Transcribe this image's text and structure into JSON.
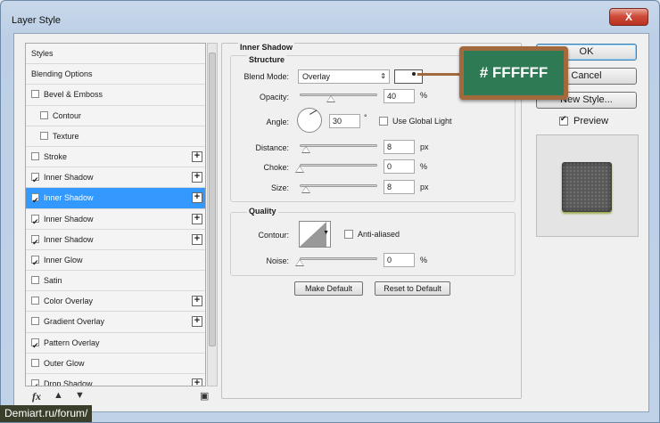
{
  "window": {
    "title": "Layer Style",
    "close_glyph": "X"
  },
  "styles_list": [
    {
      "label": "Styles",
      "checkbox": false,
      "checked": false,
      "plus": false,
      "indent": 0,
      "selected": false
    },
    {
      "label": "Blending Options",
      "checkbox": false,
      "checked": false,
      "plus": false,
      "indent": 0,
      "selected": false
    },
    {
      "label": "Bevel & Emboss",
      "checkbox": true,
      "checked": false,
      "plus": false,
      "indent": 0,
      "selected": false
    },
    {
      "label": "Contour",
      "checkbox": true,
      "checked": false,
      "plus": false,
      "indent": 1,
      "selected": false
    },
    {
      "label": "Texture",
      "checkbox": true,
      "checked": false,
      "plus": false,
      "indent": 1,
      "selected": false
    },
    {
      "label": "Stroke",
      "checkbox": true,
      "checked": false,
      "plus": true,
      "indent": 0,
      "selected": false
    },
    {
      "label": "Inner Shadow",
      "checkbox": true,
      "checked": true,
      "plus": true,
      "indent": 0,
      "selected": false
    },
    {
      "label": "Inner Shadow",
      "checkbox": true,
      "checked": true,
      "plus": true,
      "indent": 0,
      "selected": true
    },
    {
      "label": "Inner Shadow",
      "checkbox": true,
      "checked": true,
      "plus": true,
      "indent": 0,
      "selected": false
    },
    {
      "label": "Inner Shadow",
      "checkbox": true,
      "checked": true,
      "plus": true,
      "indent": 0,
      "selected": false
    },
    {
      "label": "Inner Glow",
      "checkbox": true,
      "checked": true,
      "plus": false,
      "indent": 0,
      "selected": false
    },
    {
      "label": "Satin",
      "checkbox": true,
      "checked": false,
      "plus": false,
      "indent": 0,
      "selected": false
    },
    {
      "label": "Color Overlay",
      "checkbox": true,
      "checked": false,
      "plus": true,
      "indent": 0,
      "selected": false
    },
    {
      "label": "Gradient Overlay",
      "checkbox": true,
      "checked": false,
      "plus": true,
      "indent": 0,
      "selected": false
    },
    {
      "label": "Pattern Overlay",
      "checkbox": true,
      "checked": true,
      "plus": false,
      "indent": 0,
      "selected": false
    },
    {
      "label": "Outer Glow",
      "checkbox": true,
      "checked": false,
      "plus": false,
      "indent": 0,
      "selected": false
    },
    {
      "label": "Drop Shadow",
      "checkbox": true,
      "checked": true,
      "plus": true,
      "indent": 0,
      "selected": false
    }
  ],
  "list_footer": {
    "fx_icon": "fx",
    "up_icon": "arrow-up",
    "down_icon": "arrow-down",
    "trash_icon": "trash"
  },
  "inner_shadow": {
    "title": "Inner Shadow",
    "structure": {
      "title": "Structure",
      "blend_mode_label": "Blend Mode:",
      "blend_mode_value": "Overlay",
      "swatch_color": "#FFFFFF",
      "opacity_label": "Opacity:",
      "opacity_value": "40",
      "opacity_unit": "%",
      "opacity_level": 0.4,
      "angle_label": "Angle:",
      "angle_value": "30",
      "angle_unit": "°",
      "global_light_label": "Use Global Light",
      "distance_label": "Distance:",
      "distance_value": "8",
      "distance_unit": "px",
      "choke_label": "Choke:",
      "choke_value": "0",
      "choke_unit": "%",
      "size_label": "Size:",
      "size_value": "8",
      "size_unit": "px"
    },
    "quality": {
      "title": "Quality",
      "contour_label": "Contour:",
      "anti_aliased_label": "Anti-aliased",
      "noise_label": "Noise:",
      "noise_value": "0",
      "noise_unit": "%"
    },
    "make_default": "Make Default",
    "reset_to_default": "Reset to Default"
  },
  "right_panel": {
    "ok": "OK",
    "cancel": "Cancel",
    "new_style": "New Style...",
    "preview_label": "Preview",
    "preview_checked": true
  },
  "annotation": {
    "text": "# FFFFFF",
    "board_color": "#2e7a55",
    "frame_color": "#a26a3c"
  },
  "watermark": "Demiart.ru/forum/"
}
